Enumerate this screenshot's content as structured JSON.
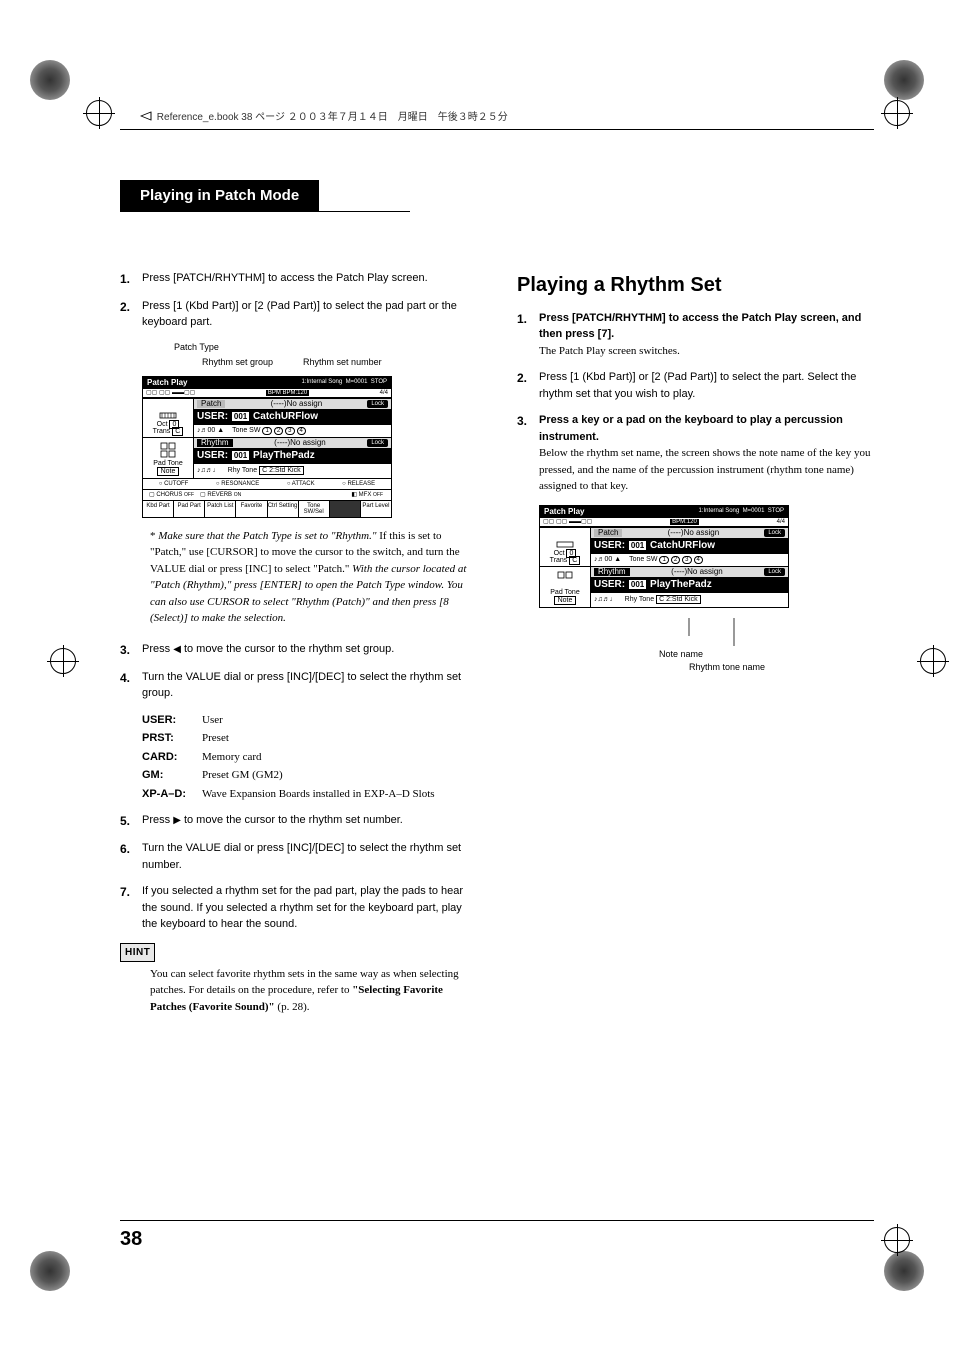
{
  "header_note": "Reference_e.book 38 ページ ２００３年７月１４日　月曜日　午後３時２５分",
  "section_title": "Playing in Patch Mode",
  "right_heading": "Playing a Rhythm Set",
  "left": {
    "s1": "Press [PATCH/RHYTHM] to access the Patch Play screen.",
    "s2": "Press [1 (Kbd Part)] or [2 (Pad Part)] to select the pad part or the keyboard part.",
    "labels": {
      "patch_type": "Patch Type",
      "rhythm_group": "Rhythm set group",
      "rhythm_number": "Rhythm set number"
    },
    "note": "Make sure that the Patch Type is set to \"Rhythm.\"",
    "note_after": " If this is set to \"Patch,\" use [CURSOR] to move the cursor to the switch, and turn the VALUE dial or press [INC] to select \"Patch.\" ",
    "note_italic2": "With the cursor located at \"Patch (Rhythm),\" press [ENTER] to open the Patch Type window. You can also use CURSOR to select \"Rhythm (Patch)\" and then press [8 (Select)] to make the selection.",
    "s3": "Press    ◀   to move the cursor to the rhythm set group.",
    "s3_pre": "Press ",
    "s3_post": " to move the cursor to the rhythm set group.",
    "s4": "Turn the VALUE dial or press [INC]/[DEC] to select the rhythm set group.",
    "defs": {
      "user_k": "USER:",
      "user_v": "User",
      "prst_k": "PRST:",
      "prst_v": "Preset",
      "card_k": "CARD:",
      "card_v": "Memory card",
      "gm_k": "GM:",
      "gm_v": "Preset GM (GM2)",
      "xp_k": "XP-A–D:",
      "xp_v": "Wave Expansion Boards installed in EXP-A–D Slots"
    },
    "s5_pre": "Press ",
    "s5_post": " to move the cursor to the rhythm set number.",
    "s6": "Turn the VALUE dial or press [INC]/[DEC] to select the rhythm set number.",
    "s7": "If you selected a rhythm set for the pad part, play the pads to hear the sound. If you selected a rhythm set for the keyboard part, play the keyboard to hear the sound.",
    "hint_label": "HINT",
    "hint_body_a": "You can select favorite rhythm sets in the same way as when selecting patches. For details on the procedure, refer to ",
    "hint_body_b": "\"Selecting Favorite Patches (Favorite Sound)\"",
    "hint_body_c": " (p. 28)."
  },
  "right": {
    "s1a": "Press [PATCH/RHYTHM] to access the Patch Play screen, and then press [7].",
    "s1b": "The Patch Play screen switches.",
    "s2": "Press [1 (Kbd Part)] or [2 (Pad Part)] to select the part. Select the rhythm set that you wish to play.",
    "s3a": "Press a key or a pad on the keyboard to play a percussion instrument.",
    "s3b": "Below the rhythm set name, the screen shows the note name of the key you pressed, and the name of the percussion instrument (rhythm tone name) assigned to that key.",
    "annot_note": "Note name",
    "annot_tone": "Rhythm tone name"
  },
  "screenshot": {
    "title": "Patch Play",
    "song": "1:Internal Song",
    "meas": "M=0001",
    "stop": "STOP",
    "bpm": "BPM:120",
    "meter": "4/4",
    "patch_lbl": "Patch",
    "noassign": "(----)No assign",
    "lock": "Lock",
    "user1": "USER:",
    "num1": "001",
    "name1": "CatchURFlow",
    "oct": "Oct",
    "octv": "0",
    "trans": "Trans",
    "transv": "C",
    "tonesw": "Tone SW",
    "rhythm_lbl": "Rhythm",
    "name2": "PlayThePadz",
    "padtone": "Pad Tone",
    "note": "Note",
    "rhytone": "Rhy Tone",
    "rhytonev": "C 2:Std Kick",
    "knobs": {
      "cutoff": "CUTOFF",
      "resonance": "RESONANCE",
      "attack": "ATTACK",
      "release": "RELEASE"
    },
    "fx": {
      "chorus": "CHORUS",
      "reverb": "REVERB",
      "mfx": "MFX"
    },
    "bottom": {
      "kbd": "Kbd Part",
      "pad": "Pad Part",
      "plist": "Patch List",
      "fav": "Favorite",
      "ctrl": "Ctrl Setting",
      "tsw": "Tone SW/Sel",
      "lvl": "Part Level"
    }
  },
  "page_number": "38"
}
